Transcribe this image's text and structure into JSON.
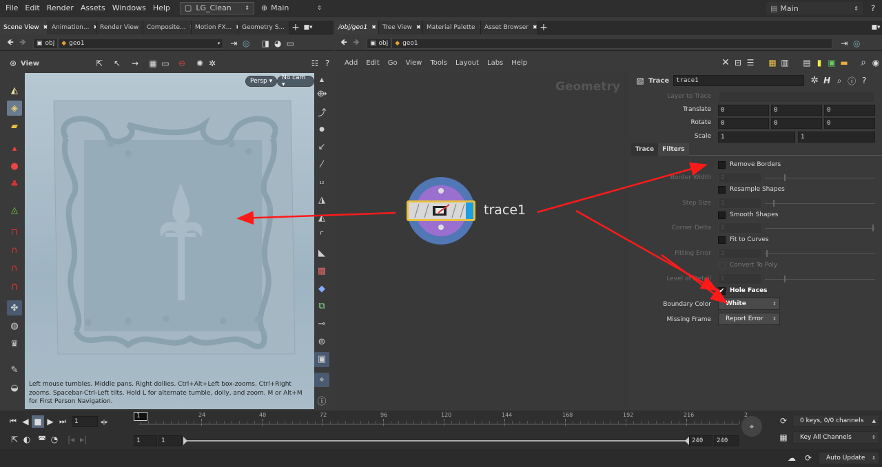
{
  "menu": {
    "items": [
      "File",
      "Edit",
      "Render",
      "Assets",
      "Windows",
      "Help"
    ],
    "desktop": "LG_Clean",
    "view": "Main",
    "right_view": "Main"
  },
  "left_tabs": [
    "Scene View",
    "Animation...",
    "Render View",
    "Composite...",
    "Motion FX...",
    "Geometry S..."
  ],
  "right_tabs": [
    "/obj/geo1",
    "Tree View",
    "Material Palette",
    "Asset Browser"
  ],
  "left_path": {
    "obj": "obj",
    "geo": "geo1"
  },
  "right_path": {
    "obj": "obj",
    "geo": "geo1"
  },
  "viewport": {
    "label": "View",
    "persp": "Persp ▾",
    "cam": "No cam ▾",
    "hint": "Left mouse tumbles. Middle pans. Right dollies. Ctrl+Alt+Left box-zooms. Ctrl+Right zooms. Spacebar-Ctrl-Left tilts. Hold L for alternate tumble, dolly, and zoom.     M or Alt+M for First Person Navigation."
  },
  "network": {
    "menu": [
      "Add",
      "Edit",
      "Go",
      "View",
      "Tools",
      "Layout",
      "Labs",
      "Help"
    ],
    "context": "Geometry",
    "node_name": "trace1"
  },
  "params": {
    "type": "Trace",
    "name": "trace1",
    "layer_label": "Layer to Trace",
    "translate": {
      "label": "Translate",
      "values": [
        "0",
        "0",
        "0"
      ]
    },
    "rotate": {
      "label": "Rotate",
      "values": [
        "0",
        "0",
        "0"
      ]
    },
    "scale": {
      "label": "Scale",
      "values": [
        "1",
        "1"
      ]
    },
    "tabs": [
      "Trace",
      "Filters"
    ],
    "remove_borders": "Remove Borders",
    "border_width": {
      "label": "Border Width",
      "value": "2"
    },
    "resample": "Resample Shapes",
    "step_size": {
      "label": "Step Size",
      "value": "1"
    },
    "smooth": "Smooth Shapes",
    "corner_delta": {
      "label": "Corner Delta",
      "value": "1"
    },
    "fit_curves": "Fit to Curves",
    "fitting_error": {
      "label": "Fitting Error",
      "value": "2"
    },
    "convert_poly": "Convert To Poly",
    "level_detail": {
      "label": "Level of Detail",
      "value": "1"
    },
    "hole_faces": "Hole Faces",
    "boundary_color": {
      "label": "Boundary Color",
      "value": "White"
    },
    "missing_frame": {
      "label": "Missing Frame",
      "value": "Report Error"
    }
  },
  "timeline": {
    "frame": "1",
    "ticks": [
      "1",
      "24",
      "48",
      "72",
      "96",
      "120",
      "144",
      "168",
      "192",
      "216",
      "2"
    ],
    "start": "1",
    "start2": "1",
    "end": "240",
    "end2": "240",
    "keys": "0 keys, 0/0 channels",
    "key_all": "Key All Channels"
  },
  "status": {
    "auto_update": "Auto Update"
  },
  "colors": {
    "arrow": "#ff1a1a",
    "accent": "#f0c020"
  }
}
